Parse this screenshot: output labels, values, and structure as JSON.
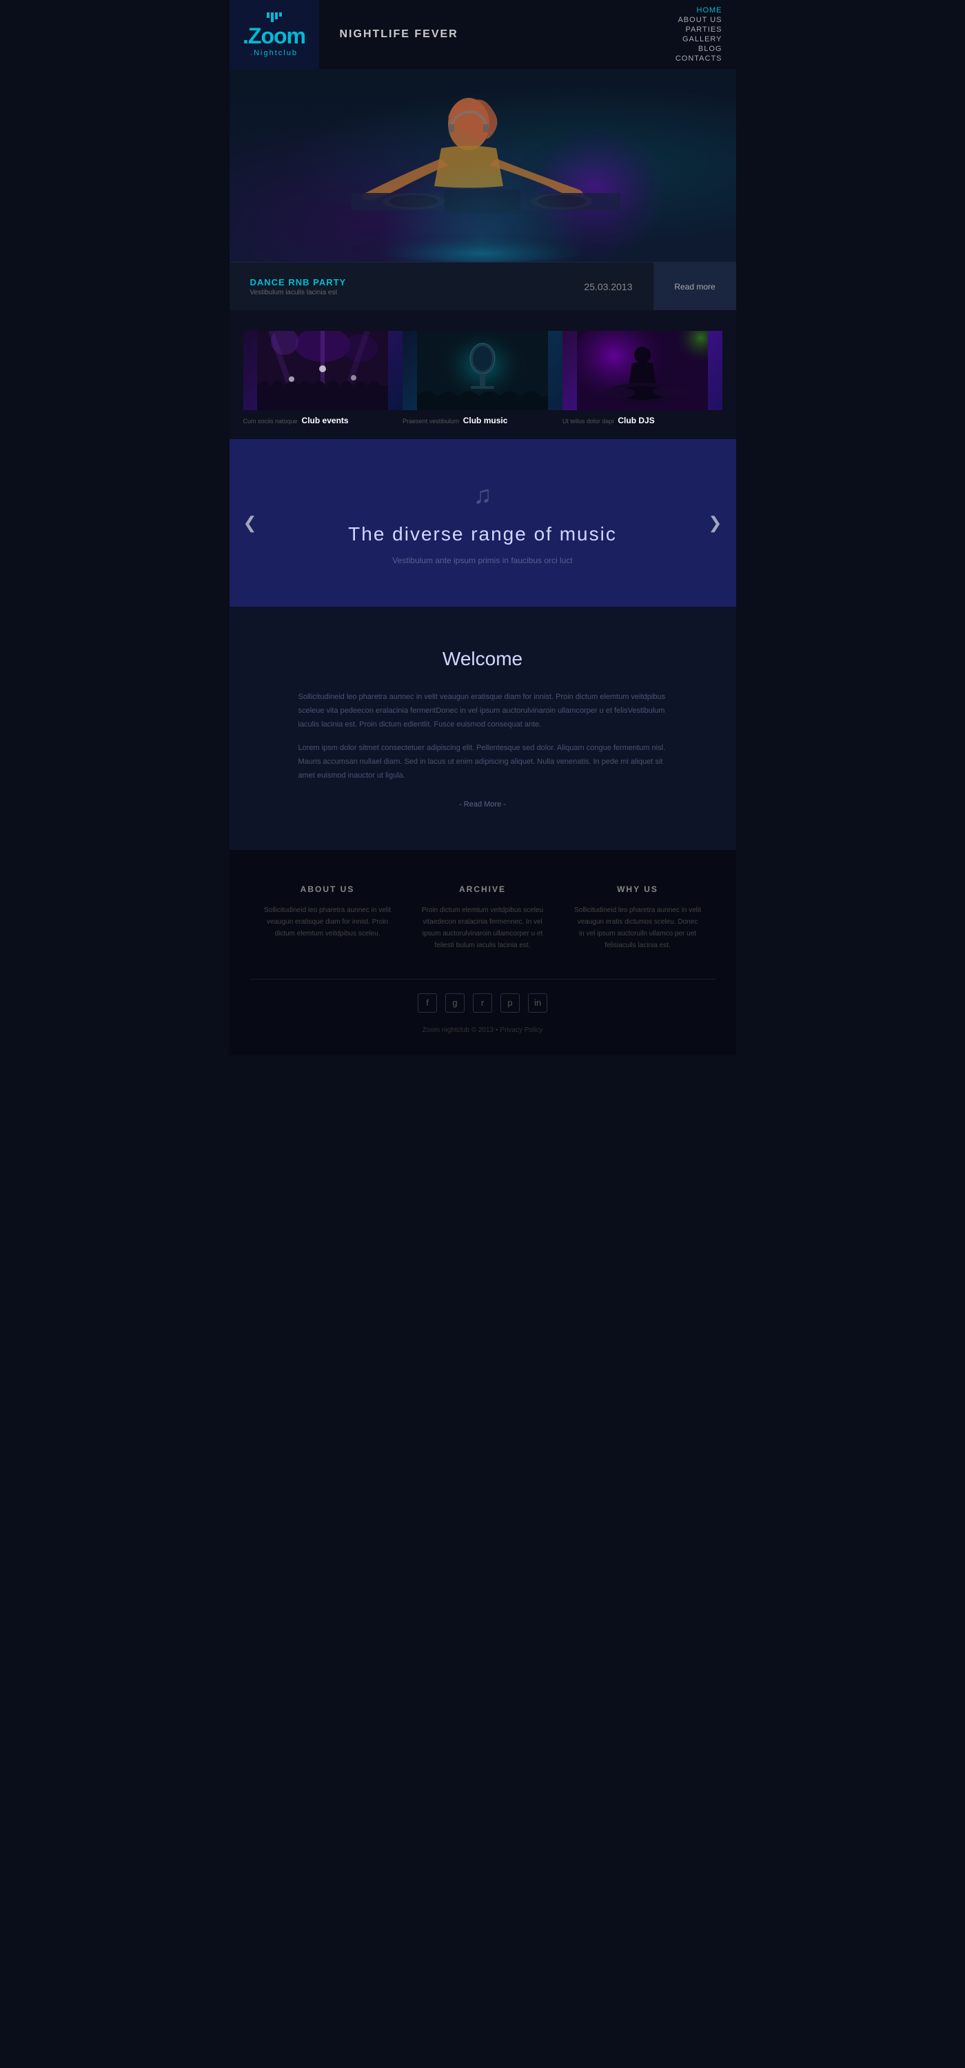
{
  "logo": {
    "brand": "Zoom",
    "sub": "Nightclub",
    "dot": ".Nightclub"
  },
  "header": {
    "title": "NIGHTLIFE FEVER"
  },
  "nav": {
    "items": [
      {
        "label": "HOME",
        "active": true
      },
      {
        "label": "ABOUT US",
        "active": false
      },
      {
        "label": "PARTIES",
        "active": false
      },
      {
        "label": "GALLERY",
        "active": false
      },
      {
        "label": "BLOG",
        "active": false
      },
      {
        "label": "CONTACTS",
        "active": false
      }
    ]
  },
  "party_bar": {
    "name": "DANCE RNB PARTY",
    "sub": "Vestibulum iaculis lacinia est",
    "date": "25.03.2013",
    "read_more": "Read more"
  },
  "categories": [
    {
      "id": "cat-events",
      "desc": "Cum sociis natoque",
      "title": "Club events"
    },
    {
      "id": "cat-music",
      "desc": "Praesent vestibulum",
      "title": "Club music"
    },
    {
      "id": "cat-djs",
      "desc": "Ut tellus dolor dapi",
      "title": "Club DJS"
    }
  ],
  "music_slider": {
    "icon": "♫",
    "title": "The diverse range of music",
    "subtitle": "Vestibulum ante ipsum primis in faucibus orci luct",
    "left_arrow": "❮",
    "right_arrow": "❯"
  },
  "welcome": {
    "title": "Welcome",
    "para1": "Sollicitudineid leo pharetra aunnec in velit veaugun eratisque diam for innist. Proin dictum elemtum veitdpibus sceleue vita pedeecon eralacinia fermentDonec in vel ipsum auctorulvinaroin ullamcorper u et felisVestibulum iaculis lacinia est. Proin dictum edientlit. Fusce euismod consequat ante.",
    "para2": "Lorem ipsm dolor sitmet consectetuer adipiscing elit. Pellentesque sed dolor. Aliquam congue fermentum nisl. Mauris accumsan nullael diam. Sed in lacus ut enim adipiscing aliquet. Nulla venenatis. In pede mi aliquet sit amet euismod inauctor ut ligula.",
    "read_more": "- Read More -"
  },
  "footer": {
    "col1": {
      "title": "ABOUT US",
      "text": "Sollicitudineid leo pharetra aunnec in velit veaugun eratisque diam for innist. Proin dictum elemtum veitdpibus sceleu."
    },
    "col2": {
      "title": "ARCHIVE",
      "text": "Proin dictum elemtum veitdpibus sceleu vitaedecon eralacinia fermennec. In vel ipsum auctorulvinaroin ullamcorper u et feliesti bulum iaculis lacinia est."
    },
    "col3": {
      "title": "WHY US",
      "text": "Sollicitudineid leo pharetra aunnec in velit veaugun eratis dictumos sceleu. Donec in vel ipsum auctoruiln ullamco per uet felisiacuils lacinia est."
    },
    "social_icons": [
      "f",
      "g+",
      "rss",
      "p",
      "in"
    ],
    "copyright": "Zoom nightclub © 2013 • Privacy Policy"
  }
}
